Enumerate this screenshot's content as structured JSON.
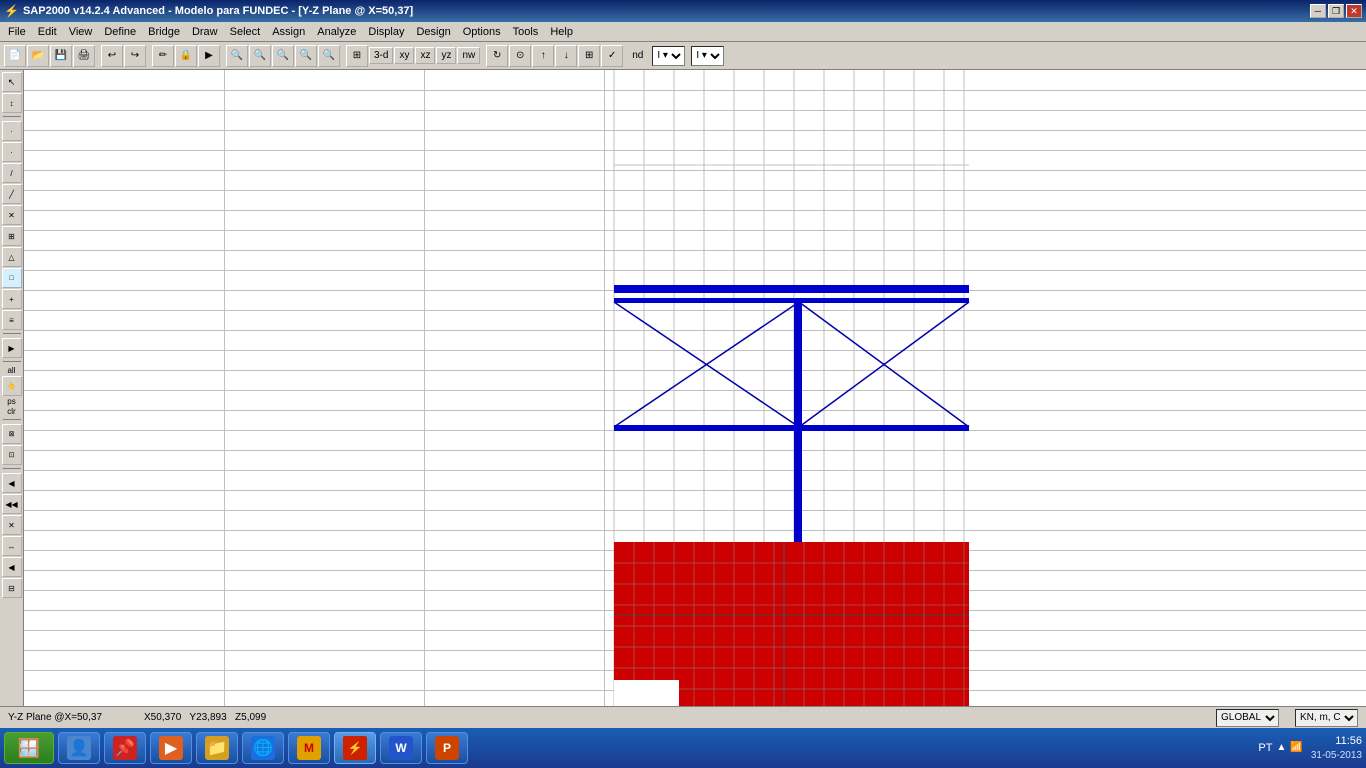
{
  "titlebar": {
    "title": "SAP2000 v14.2.4 Advanced  - Modelo para FUNDEC - [Y-Z Plane @ X=50,37]",
    "minimize": "─",
    "maximize": "□",
    "restore": "❐",
    "close": "✕"
  },
  "menubar": {
    "items": [
      "File",
      "Edit",
      "View",
      "Define",
      "Bridge",
      "Draw",
      "Select",
      "Assign",
      "Analyze",
      "Display",
      "Design",
      "Options",
      "Tools",
      "Help"
    ]
  },
  "toolbar": {
    "buttons": [
      "📁",
      "💾",
      "🖨",
      "↩",
      "↪",
      "✏",
      "🔒",
      "▶",
      "⊕",
      "🔍",
      "🔍",
      "🔍",
      "🔍",
      "🔍",
      "🔲",
      "3-d",
      "xy",
      "xz",
      "yz",
      "nw",
      "↻",
      "⊙",
      "↑",
      "↓",
      "⊞",
      "✓",
      "nd"
    ],
    "dropdown": "I ▾",
    "dropdown2": "I ▾"
  },
  "left_toolbar": {
    "buttons": [
      "↖",
      "↕",
      "·",
      "·",
      "/",
      "\\",
      "✕",
      "⊞",
      "△",
      "□",
      "+",
      "📋",
      "▶",
      "all",
      "ps",
      "clr",
      "⊠",
      "⊡",
      "◀",
      "◀",
      "✕",
      "↔",
      "◀",
      "⊟"
    ]
  },
  "canvas": {
    "view_label": "Y-Z Plane @X=50,37",
    "bg_color": "#ffffff",
    "grid_color": "#c0c0c0",
    "beam_color": "#0000cc",
    "red_fill_color": "#cc0000",
    "support_color": "#00cc00"
  },
  "status_bar": {
    "plane": "Y-Z Plane @X=50,37",
    "x": "X50,370",
    "y": "Y23,893",
    "z": "Z5,099",
    "coord_system": "GLOBAL",
    "units": "KN, m, C"
  },
  "taskbar": {
    "start_label": "⊞",
    "apps": [
      {
        "label": "Windows",
        "icon": "🪟"
      },
      {
        "label": "User",
        "icon": "👤"
      },
      {
        "label": "Pin",
        "icon": "📌"
      },
      {
        "label": "Media",
        "icon": "▶"
      },
      {
        "label": "Explorer",
        "icon": "📁"
      },
      {
        "label": "IE",
        "icon": "🌐"
      },
      {
        "label": "MATLAB",
        "icon": "M"
      },
      {
        "label": "SAP",
        "icon": "⚡"
      },
      {
        "label": "Word",
        "icon": "W"
      },
      {
        "label": "PowerPoint",
        "icon": "P"
      }
    ],
    "tray": {
      "lang": "PT",
      "signal": "▲",
      "time": "11:56",
      "date": "31-05-2013"
    }
  }
}
